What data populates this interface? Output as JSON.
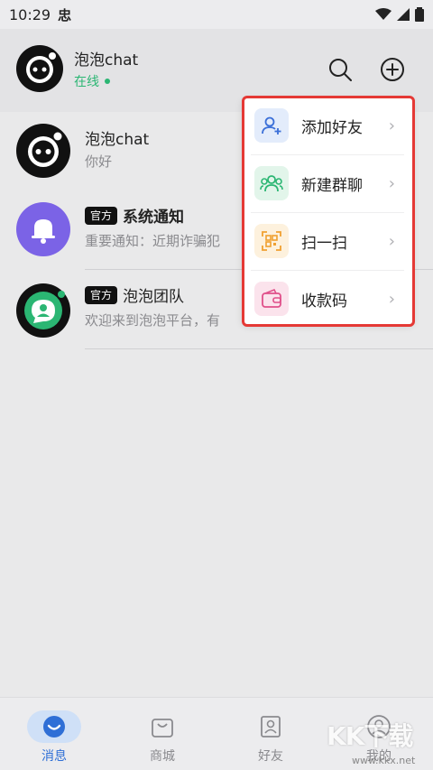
{
  "status_bar": {
    "time": "10:29",
    "app_icon_char": "忠"
  },
  "header": {
    "name": "泡泡chat",
    "status": "在线",
    "status_color": "#2bb673"
  },
  "chats": [
    {
      "title": "泡泡chat",
      "badge": "",
      "preview": "你好",
      "avatar": "logo-avatar"
    },
    {
      "title": "系统通知",
      "badge": "官方",
      "preview": "重要通知：近期诈骗犯",
      "avatar": "bell-avatar",
      "avatar_color": "#7b63e6"
    },
    {
      "title": "泡泡团队",
      "badge": "官方",
      "preview": "欢迎来到泡泡平台，有",
      "avatar": "team-avatar",
      "avatar_color": "#2bb673"
    }
  ],
  "menu": {
    "highlight_color": "#e53935",
    "items": [
      {
        "label": "添加好友",
        "icon": "add-friend-icon",
        "icon_bg": "#e3ecfb",
        "icon_color": "#3a6fd8"
      },
      {
        "label": "新建群聊",
        "icon": "group-chat-icon",
        "icon_bg": "#e2f5ea",
        "icon_color": "#2bb673"
      },
      {
        "label": "扫一扫",
        "icon": "scan-icon",
        "icon_bg": "#fdf1dd",
        "icon_color": "#f0a030"
      },
      {
        "label": "收款码",
        "icon": "wallet-icon",
        "icon_bg": "#fbe3ec",
        "icon_color": "#e0508a"
      }
    ],
    "chevron": "›"
  },
  "bottom_nav": {
    "items": [
      {
        "label": "消息",
        "icon": "message-icon",
        "active": true
      },
      {
        "label": "商城",
        "icon": "shop-icon",
        "active": false
      },
      {
        "label": "好友",
        "icon": "contacts-icon",
        "active": false
      },
      {
        "label": "我的",
        "icon": "profile-icon",
        "active": false
      }
    ],
    "active_color": "#2f6fd6"
  },
  "watermark": {
    "text": "KK下载",
    "url": "www.kkx.net"
  }
}
